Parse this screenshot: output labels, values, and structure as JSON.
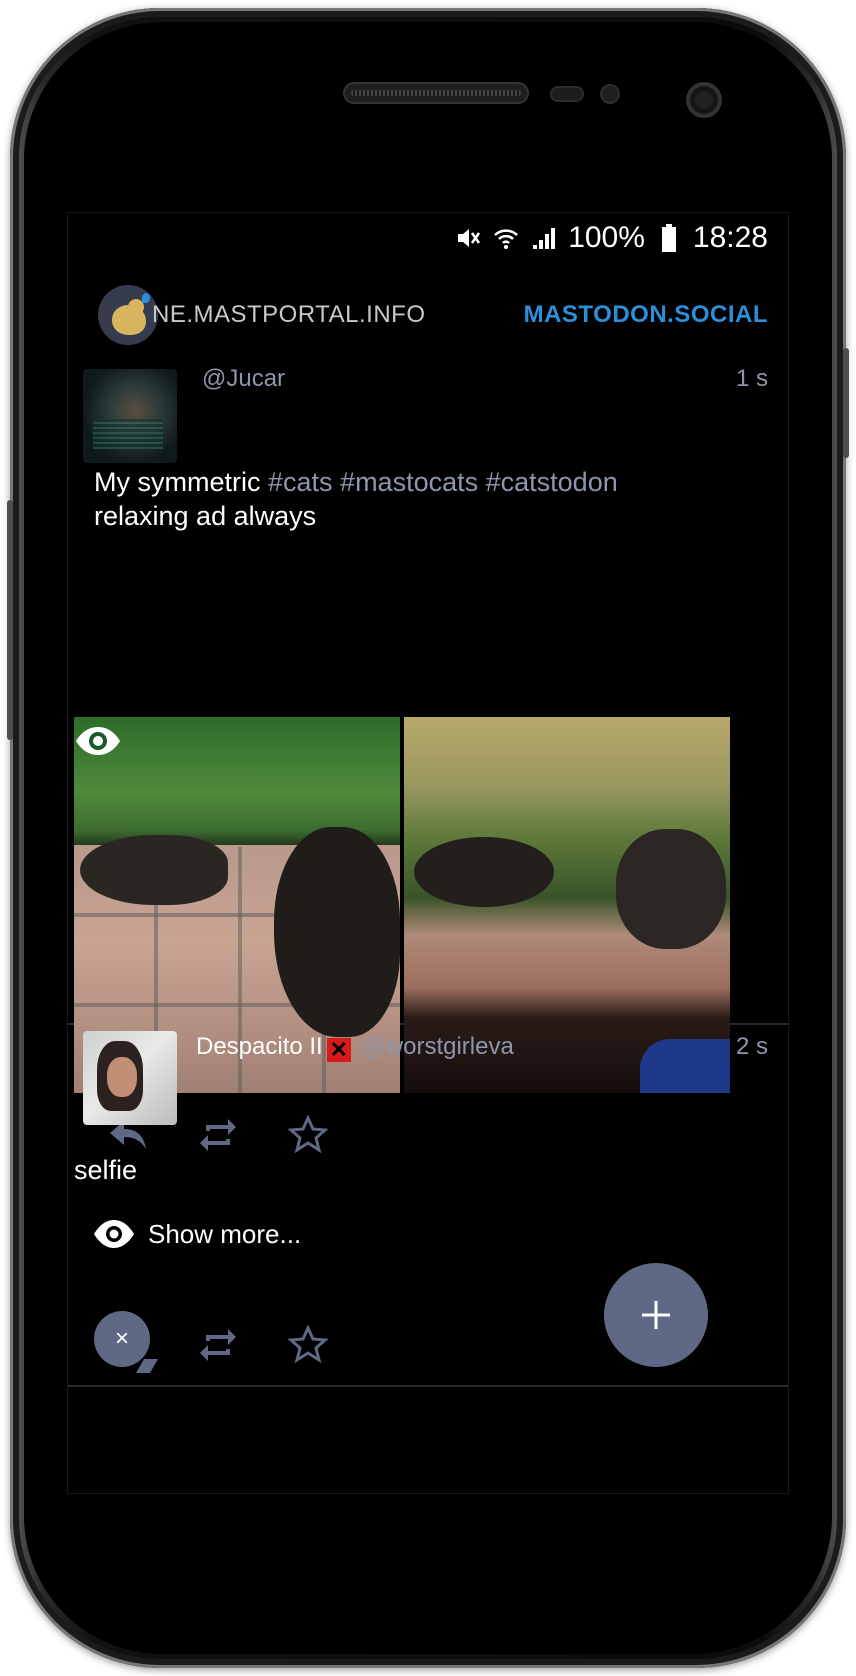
{
  "status_bar": {
    "battery": "100%",
    "time": "18:28"
  },
  "header": {
    "tab_primary": "NE.MASTPORTAL.INFO",
    "tab_secondary": "MASTODON.SOCIAL"
  },
  "posts": [
    {
      "display_name": "",
      "handle": "@Jucar",
      "time": "1 s",
      "text_plain": "My symmetric ",
      "hashtags": [
        "#cats",
        "#mastocats",
        "#catstodon"
      ],
      "text_after": "relaxing ad always",
      "media_count": 2
    },
    {
      "display_name": "Despacito II",
      "name_badge": "✕",
      "handle": "@worstgirleva",
      "time": "2 s",
      "text": "selfie",
      "show_more": "Show more..."
    }
  ],
  "fab": {
    "symbol": "+"
  },
  "close_bubble": {
    "symbol": "×"
  },
  "colors": {
    "accent": "#2b90d9",
    "muted": "#8e96ab",
    "fab": "#5f6884",
    "background": "#000000"
  },
  "icons": [
    "eye-icon",
    "reply-icon",
    "boost-icon",
    "favourite-icon",
    "plus-icon",
    "close-icon",
    "mute-icon",
    "wifi-icon",
    "signal-icon",
    "battery-icon"
  ]
}
